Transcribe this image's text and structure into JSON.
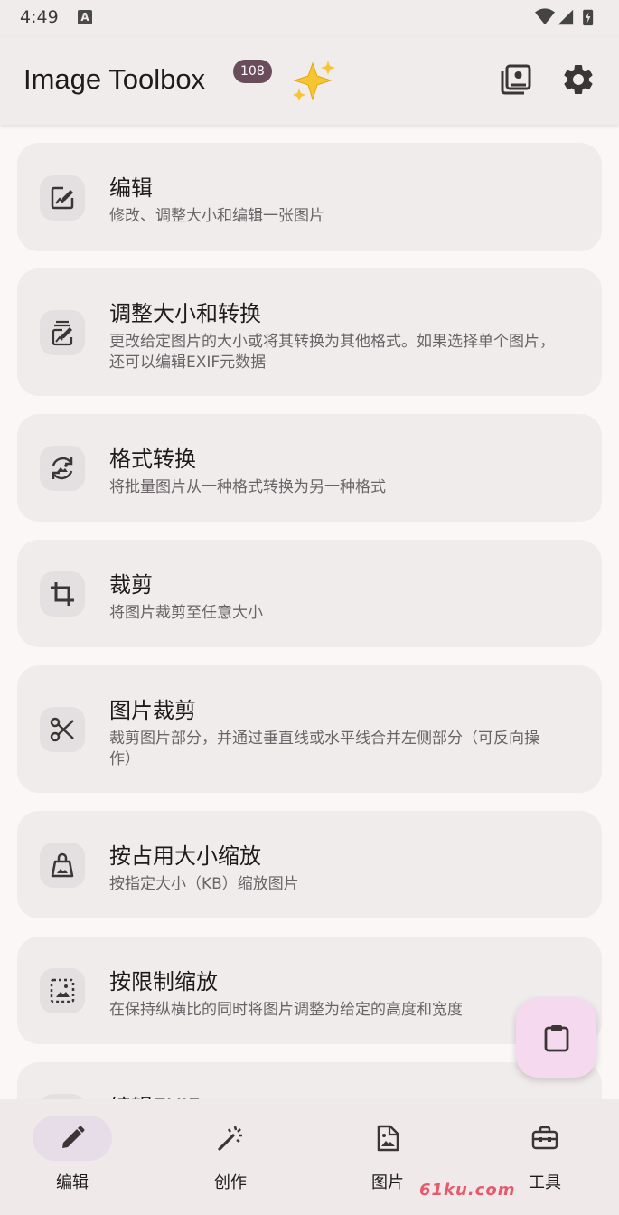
{
  "status_bar": {
    "time": "4:49",
    "notification_letter": "A"
  },
  "topbar": {
    "title": "Image Toolbox",
    "version_badge": "108",
    "sparkle_icon": "sparkles-icon",
    "actions": [
      {
        "name": "image-gallery-icon"
      },
      {
        "name": "gear-icon"
      }
    ]
  },
  "tools": [
    {
      "title": "编辑",
      "desc": "修改、调整大小和编辑一张图片",
      "icon": "image-edit-icon"
    },
    {
      "title": "调整大小和转换",
      "desc": "更改给定图片的大小或将其转换为其他格式。如果选择单个图片，还可以编辑EXIF元数据",
      "icon": "resize-convert-icon"
    },
    {
      "title": "格式转换",
      "desc": "将批量图片从一种格式转换为另一种格式",
      "icon": "format-convert-icon"
    },
    {
      "title": "裁剪",
      "desc": "将图片裁剪至任意大小",
      "icon": "crop-icon"
    },
    {
      "title": "图片裁剪",
      "desc": "裁剪图片部分，并通过垂直线或水平线合并左侧部分（可反向操作）",
      "icon": "scissors-icon"
    },
    {
      "title": "按占用大小缩放",
      "desc": "按指定大小（KB）缩放图片",
      "icon": "weight-icon"
    },
    {
      "title": "按限制缩放",
      "desc": "在保持纵横比的同时将图片调整为给定的高度和宽度",
      "icon": "limit-resize-icon"
    },
    {
      "title": "编辑EXIF",
      "desc": "",
      "icon": "exif-icon"
    }
  ],
  "fab": {
    "icon": "clipboard-icon"
  },
  "bottom_nav": [
    {
      "label": "编辑",
      "icon": "pencil-icon",
      "active": true
    },
    {
      "label": "创作",
      "icon": "magic-wand-icon",
      "active": false
    },
    {
      "label": "图片",
      "icon": "image-file-icon",
      "active": false
    },
    {
      "label": "工具",
      "icon": "toolbox-icon",
      "active": false
    }
  ],
  "watermark": "61ku.com",
  "colors": {
    "accent": "#6a4c5b",
    "card": "#f1ecec",
    "fab": "#f5d9ef",
    "nav_active": "#e6dde9"
  }
}
